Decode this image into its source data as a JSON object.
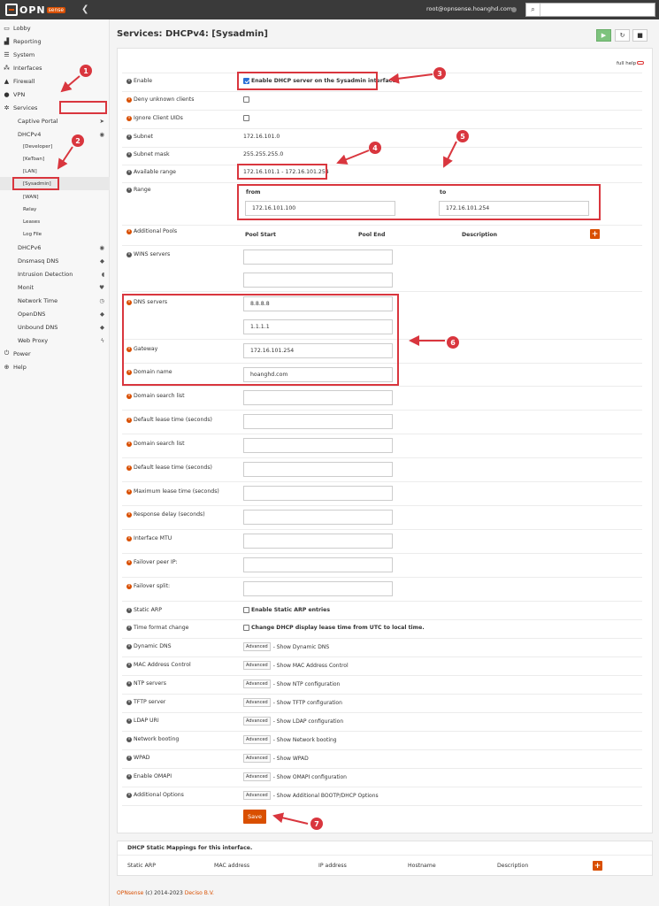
{
  "topbar": {
    "logo_text": "OPN",
    "logo_sense": "sense",
    "user": "root@opnsense.hoanghd.com",
    "search_placeholder": ""
  },
  "sidebar": {
    "lobby": "Lobby",
    "reporting": "Reporting",
    "system": "System",
    "interfaces": "Interfaces",
    "firewall": "Firewall",
    "vpn": "VPN",
    "services": "Services",
    "captive_portal": "Captive Portal",
    "dhcpv4": "DHCPv4",
    "developer": "[Developer]",
    "ketoan": "[KeToan]",
    "lan": "[LAN]",
    "sysadmin": "[Sysadmin]",
    "wan": "[WAN]",
    "relay": "Relay",
    "leases": "Leases",
    "log_file": "Log File",
    "dhcpv6": "DHCPv6",
    "dnsmasq": "Dnsmasq DNS",
    "intrusion": "Intrusion Detection",
    "monit": "Monit",
    "network_time": "Network Time",
    "opendns": "OpenDNS",
    "unbound": "Unbound DNS",
    "web_proxy": "Web Proxy",
    "power": "Power",
    "help": "Help"
  },
  "page": {
    "title": "Services: DHCPv4: [Sysadmin]",
    "full_help": "full help"
  },
  "form": {
    "enable_label": "Enable",
    "enable_text": "Enable DHCP server on the Sysadmin interface",
    "deny_label": "Deny unknown clients",
    "ignore_label": "Ignore Client UIDs",
    "subnet_label": "Subnet",
    "subnet_val": "172.16.101.0",
    "mask_label": "Subnet mask",
    "mask_val": "255.255.255.0",
    "avail_label": "Available range",
    "avail_val": "172.16.101.1 - 172.16.101.254",
    "range_label": "Range",
    "range_from": "from",
    "range_to": "to",
    "from_val": "172.16.101.100",
    "to_val": "172.16.101.254",
    "pools_label": "Additional Pools",
    "pool_start": "Pool Start",
    "pool_end": "Pool End",
    "pool_desc": "Description",
    "wins_label": "WINS servers",
    "dns_label": "DNS servers",
    "dns1": "8.8.8.8",
    "dns2": "1.1.1.1",
    "gw_label": "Gateway",
    "gw_val": "172.16.101.254",
    "domain_label": "Domain name",
    "domain_val": "hoanghd.com",
    "dsl1_label": "Domain search list",
    "dlt1_label": "Default lease time (seconds)",
    "dsl2_label": "Domain search list",
    "dlt2_label": "Default lease time (seconds)",
    "mlt_label": "Maximum lease time (seconds)",
    "rd_label": "Response delay (seconds)",
    "mtu_label": "Interface MTU",
    "fpi_label": "Failover peer IP:",
    "fs_label": "Failover split:",
    "sarp_label": "Static ARP",
    "sarp_text": "Enable Static ARP entries",
    "tfc_label": "Time format change",
    "tfc_text": "Change DHCP display lease time from UTC to local time.",
    "advanced": "Advanced",
    "ddns_label": "Dynamic DNS",
    "ddns_text": "- Show Dynamic DNS",
    "mac_label": "MAC Address Control",
    "mac_text": "- Show MAC Address Control",
    "ntp_label": "NTP servers",
    "ntp_text": "- Show NTP configuration",
    "tftp_label": "TFTP server",
    "tftp_text": "- Show TFTP configuration",
    "ldap_label": "LDAP URI",
    "ldap_text": "- Show LDAP configuration",
    "nb_label": "Network booting",
    "nb_text": "- Show Network booting",
    "wpad_label": "WPAD",
    "wpad_text": "- Show WPAD",
    "omapi_label": "Enable OMAPI",
    "omapi_text": "- Show OMAPI configuration",
    "ao_label": "Additional Options",
    "ao_text": "- Show Additional BOOTP/DHCP Options",
    "save": "Save"
  },
  "mappings": {
    "title": "DHCP Static Mappings for this interface.",
    "col_arp": "Static ARP",
    "col_mac": "MAC address",
    "col_ip": "IP address",
    "col_host": "Hostname",
    "col_desc": "Description"
  },
  "footer": {
    "brand": "OPNsense",
    "copy": "(c) 2014-2023",
    "company": "Deciso B.V."
  },
  "badges": [
    "1",
    "2",
    "3",
    "4",
    "5",
    "6",
    "7"
  ],
  "colors": {
    "accent": "#d94f00",
    "annotation": "#d9363e",
    "topbar": "#3a3a3a"
  }
}
